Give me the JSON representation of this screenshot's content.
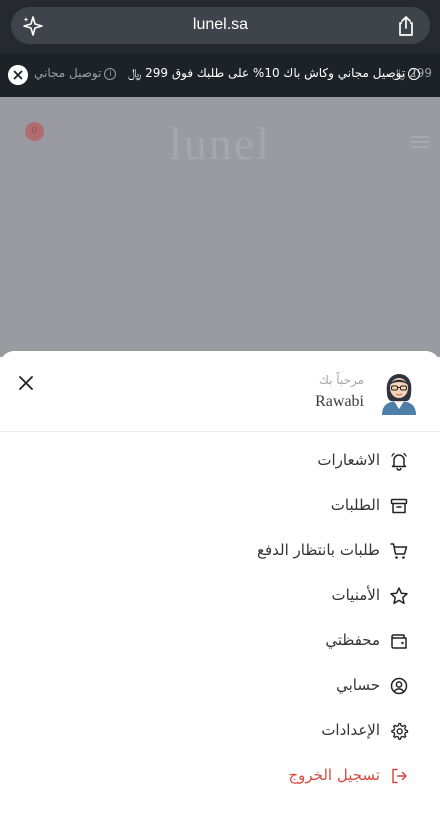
{
  "browser": {
    "url": "lunel.sa",
    "sparkle_icon": "sparkle-icon",
    "share_icon": "share-icon"
  },
  "announcement": {
    "items": [
      "توصيل مجاني",
      "توصيل مجاني وكاش باك 10% على طلبك فوق 299 ﷼",
      "299 ﷼"
    ],
    "close_icon": "close-icon"
  },
  "backdrop": {
    "logo_text": "lunel",
    "cart_count": "0"
  },
  "sheet": {
    "welcome": "مرحباً بك",
    "username": "Rawabi",
    "menu": [
      {
        "label": "الاشعارات",
        "icon": "bell-icon"
      },
      {
        "label": "الطلبات",
        "icon": "archive-box-icon"
      },
      {
        "label": "طلبات بانتظار الدفع",
        "icon": "cart-icon"
      },
      {
        "label": "الأمنيات",
        "icon": "star-icon"
      },
      {
        "label": "محفظتي",
        "icon": "wallet-icon"
      },
      {
        "label": "حسابي",
        "icon": "user-circle-icon"
      },
      {
        "label": "الإعدادات",
        "icon": "gear-icon"
      },
      {
        "label": "تسجيل الخروج",
        "icon": "logout-icon"
      }
    ]
  },
  "colors": {
    "logout": "#d64b3e",
    "dark_bar": "#1d2128",
    "backdrop": "#9a9ba0"
  }
}
